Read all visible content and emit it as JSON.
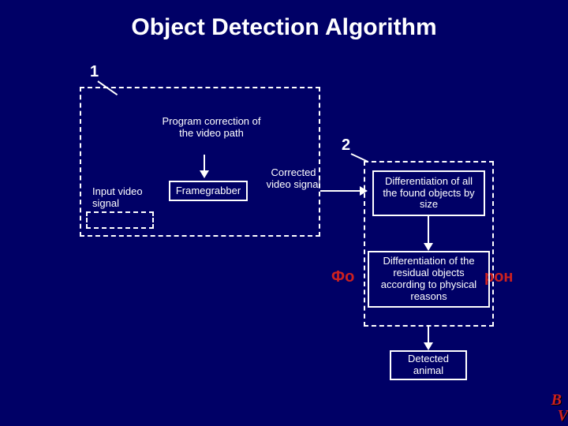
{
  "title": "Object Detection Algorithm",
  "labels": {
    "one": "1",
    "two": "2"
  },
  "box1": {
    "program_correction": "Program correction of the video path",
    "input": "Input video signal",
    "framegrabber": "Framegrabber",
    "corrected": "Corrected video signal"
  },
  "box2": {
    "diff_size": "Differentiation of all the found objects by size",
    "diff_physical": "Differentiation of the residual objects according to physical reasons",
    "detected": "Detected animal"
  },
  "bg_text": {
    "left_frag": "Фо",
    "right_frag": "рон"
  },
  "logo": {
    "b": "B",
    "v": "V"
  }
}
